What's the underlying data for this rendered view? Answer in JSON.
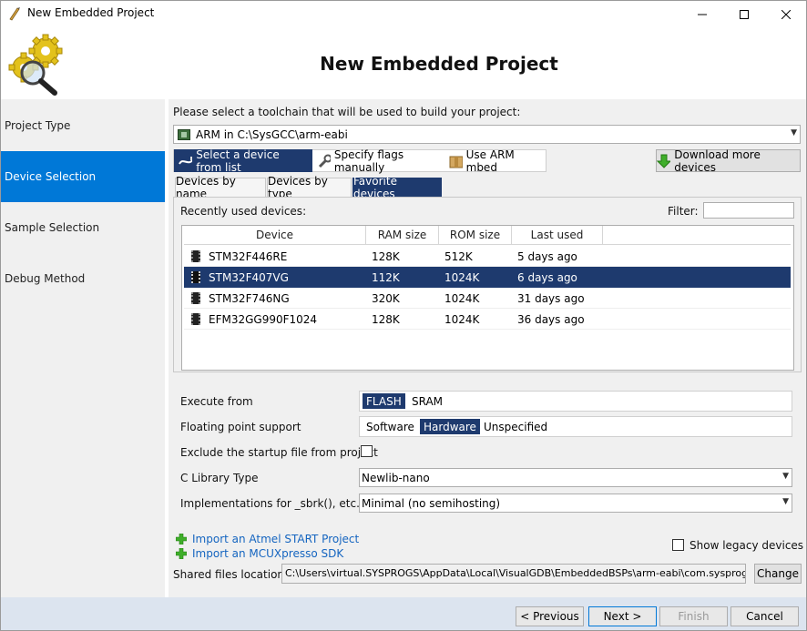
{
  "window": {
    "title": "New Embedded Project"
  },
  "header": {
    "title": "New Embedded Project"
  },
  "nav": {
    "items": [
      {
        "label": "Project Type"
      },
      {
        "label": "Device Selection"
      },
      {
        "label": "Sample Selection"
      },
      {
        "label": "Debug Method"
      }
    ]
  },
  "toolchain": {
    "prompt": "Please select a toolchain that will be used to build your project:",
    "selected": "ARM in C:\\SysGCC\\arm-eabi"
  },
  "mode_buttons": {
    "select_from_list": "Select a device from list",
    "specify_flags": "Specify flags manually",
    "use_mbed": "Use ARM mbed"
  },
  "download_button": "Download more devices",
  "tabs": [
    {
      "label": "Devices by name"
    },
    {
      "label": "Devices by type"
    },
    {
      "label": "Favorite devices"
    }
  ],
  "favorites": {
    "recent_label": "Recently used devices:",
    "filter_label": "Filter:",
    "filter_value": "",
    "columns": [
      "Device",
      "RAM size",
      "ROM size",
      "Last used"
    ],
    "rows": [
      {
        "device": "STM32F446RE",
        "ram": "128K",
        "rom": "512K",
        "last_used": "5 days ago"
      },
      {
        "device": "STM32F407VG",
        "ram": "112K",
        "rom": "1024K",
        "last_used": "6 days ago"
      },
      {
        "device": "STM32F746NG",
        "ram": "320K",
        "rom": "1024K",
        "last_used": "31 days ago"
      },
      {
        "device": "EFM32GG990F1024",
        "ram": "128K",
        "rom": "1024K",
        "last_used": "36 days ago"
      }
    ]
  },
  "settings": {
    "execute_from": {
      "label": "Execute from",
      "options": [
        "FLASH",
        "SRAM"
      ],
      "selected": "FLASH"
    },
    "floating_point": {
      "label": "Floating point support",
      "options": [
        "Software",
        "Hardware",
        "Unspecified"
      ],
      "selected": "Hardware"
    },
    "exclude_startup": {
      "label": "Exclude the startup file from project",
      "checked": false
    },
    "c_library": {
      "label": "C Library Type",
      "value": "Newlib-nano"
    },
    "sbrk": {
      "label": "Implementations for _sbrk(), etc.",
      "value": "Minimal (no semihosting)"
    }
  },
  "imports": {
    "atmel": "Import an Atmel START Project",
    "mcuxpresso": "Import an MCUXpresso SDK"
  },
  "show_legacy": {
    "label": "Show legacy devices",
    "checked": false
  },
  "shared_files": {
    "label": "Shared files location:",
    "path": "C:\\Users\\virtual.SYSPROGS\\AppData\\Local\\VisualGDB\\EmbeddedBSPs\\arm-eabi\\com.sysprogs.a",
    "change_button": "Change"
  },
  "footer": {
    "previous": "< Previous",
    "next": "Next >",
    "finish": "Finish",
    "cancel": "Cancel"
  },
  "colors": {
    "accent": "#0078d7",
    "selection": "#1e3a6e",
    "link": "#1565c0",
    "footer_bg": "#dce4ef"
  }
}
